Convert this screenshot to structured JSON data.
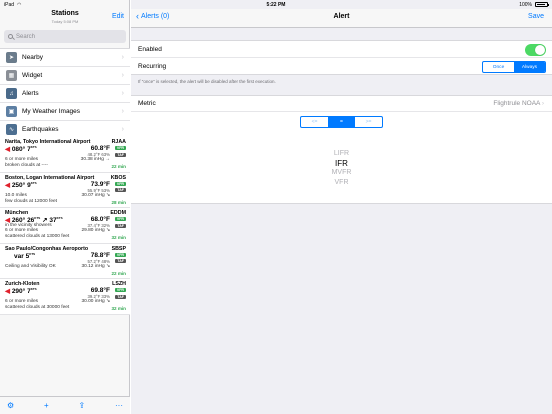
{
  "status": {
    "carrier": "iPad",
    "time": "5:22 PM",
    "battery": "100%"
  },
  "left": {
    "title": "Stations",
    "subtitle": "Today 5:08 PM",
    "edit_label": "Edit",
    "search_placeholder": "Search",
    "menu": [
      {
        "label": "Nearby",
        "icon": "location-icon"
      },
      {
        "label": "Widget",
        "icon": "widget-icon"
      },
      {
        "label": "Alerts",
        "icon": "bell-icon"
      },
      {
        "label": "My Weather Images",
        "icon": "image-icon"
      },
      {
        "label": "Earthquakes",
        "icon": "earthquake-icon"
      }
    ],
    "stations": [
      {
        "name": "Narita, Tokyo International Airport",
        "icao": "RJAA",
        "wind": "080° 7",
        "wind_unit": "KTS",
        "temp": "60.8°F",
        "dew": "48.2°F 63%",
        "vis": "6 or more miles",
        "press": "30.38 inHg →",
        "cloud": "broken clouds at ----",
        "age": "22 min",
        "flight": "VFR",
        "taf": "TAF"
      },
      {
        "name": "Boston, Logan International Airport",
        "icao": "KBOS",
        "wind": "250° 9",
        "wind_unit": "KTS",
        "temp": "73.9°F",
        "dew": "55.9°F 53%",
        "vis": "10.0 miles",
        "press": "30.07 inHg ↘",
        "cloud": "few clouds at 12000 feet",
        "age": "28 min",
        "flight": "VFR",
        "taf": "TAF"
      },
      {
        "name": "München",
        "icao": "EDDM",
        "wind": "260° 26",
        "wind_unit": "KTS",
        "wind_gust": "37",
        "temp": "68.0°F",
        "dew": "37.4°F 32%",
        "wx": "in the vicinity showers",
        "vis": "6 or more miles",
        "press": "29.80 inHg ↘",
        "cloud": "scattered clouds at 13000 feet",
        "age": "32 min",
        "flight": "VFR",
        "taf": "TAF"
      },
      {
        "name": "Sao Paulo/Congonhas Aeroporto",
        "icao": "SBSP",
        "wind": "var 5",
        "wind_unit": "KTS",
        "temp": "78.8°F",
        "dew": "57.2°F 48%",
        "vis": "Ceiling and Visibility OK",
        "press": "30.12 inHg ↘",
        "cloud": "",
        "age": "22 min",
        "flight": "VFR",
        "taf": "TAF"
      },
      {
        "name": "Zurich-Kloten",
        "icao": "LSZH",
        "wind": "290° 7",
        "wind_unit": "KTS",
        "temp": "69.8°F",
        "dew": "39.2°F 33%",
        "vis": "6 or more miles",
        "press": "30.00 inHg ↘",
        "cloud": "scattered clouds at 30000 feet",
        "age": "32 min",
        "flight": "VFR",
        "taf": "TAF"
      }
    ],
    "toolbar": [
      "settings-icon",
      "add-icon",
      "share-icon",
      "more-icon"
    ]
  },
  "right": {
    "back_label": "Alerts (0)",
    "title": "Alert",
    "save_label": "Save",
    "enabled_label": "Enabled",
    "enabled": true,
    "recurring_label": "Recurring",
    "recurring_options": [
      "Once",
      "Always"
    ],
    "recurring_selected": "Always",
    "note": "If \"once\" is selected, the alert will be disabled after the first execution.",
    "metric_label": "Metric",
    "metric_value": "Flightrule NOAA",
    "operators": [
      "<=",
      "=",
      ">="
    ],
    "operator_selected": "=",
    "picker_values": [
      "LIFR",
      "IFR",
      "MVFR",
      "VFR"
    ],
    "picker_selected": "IFR"
  },
  "colors": {
    "accent": "#007aff",
    "toggle_on": "#4cd964",
    "vfr": "#34a853",
    "wind_arrow": "#e0212c"
  }
}
